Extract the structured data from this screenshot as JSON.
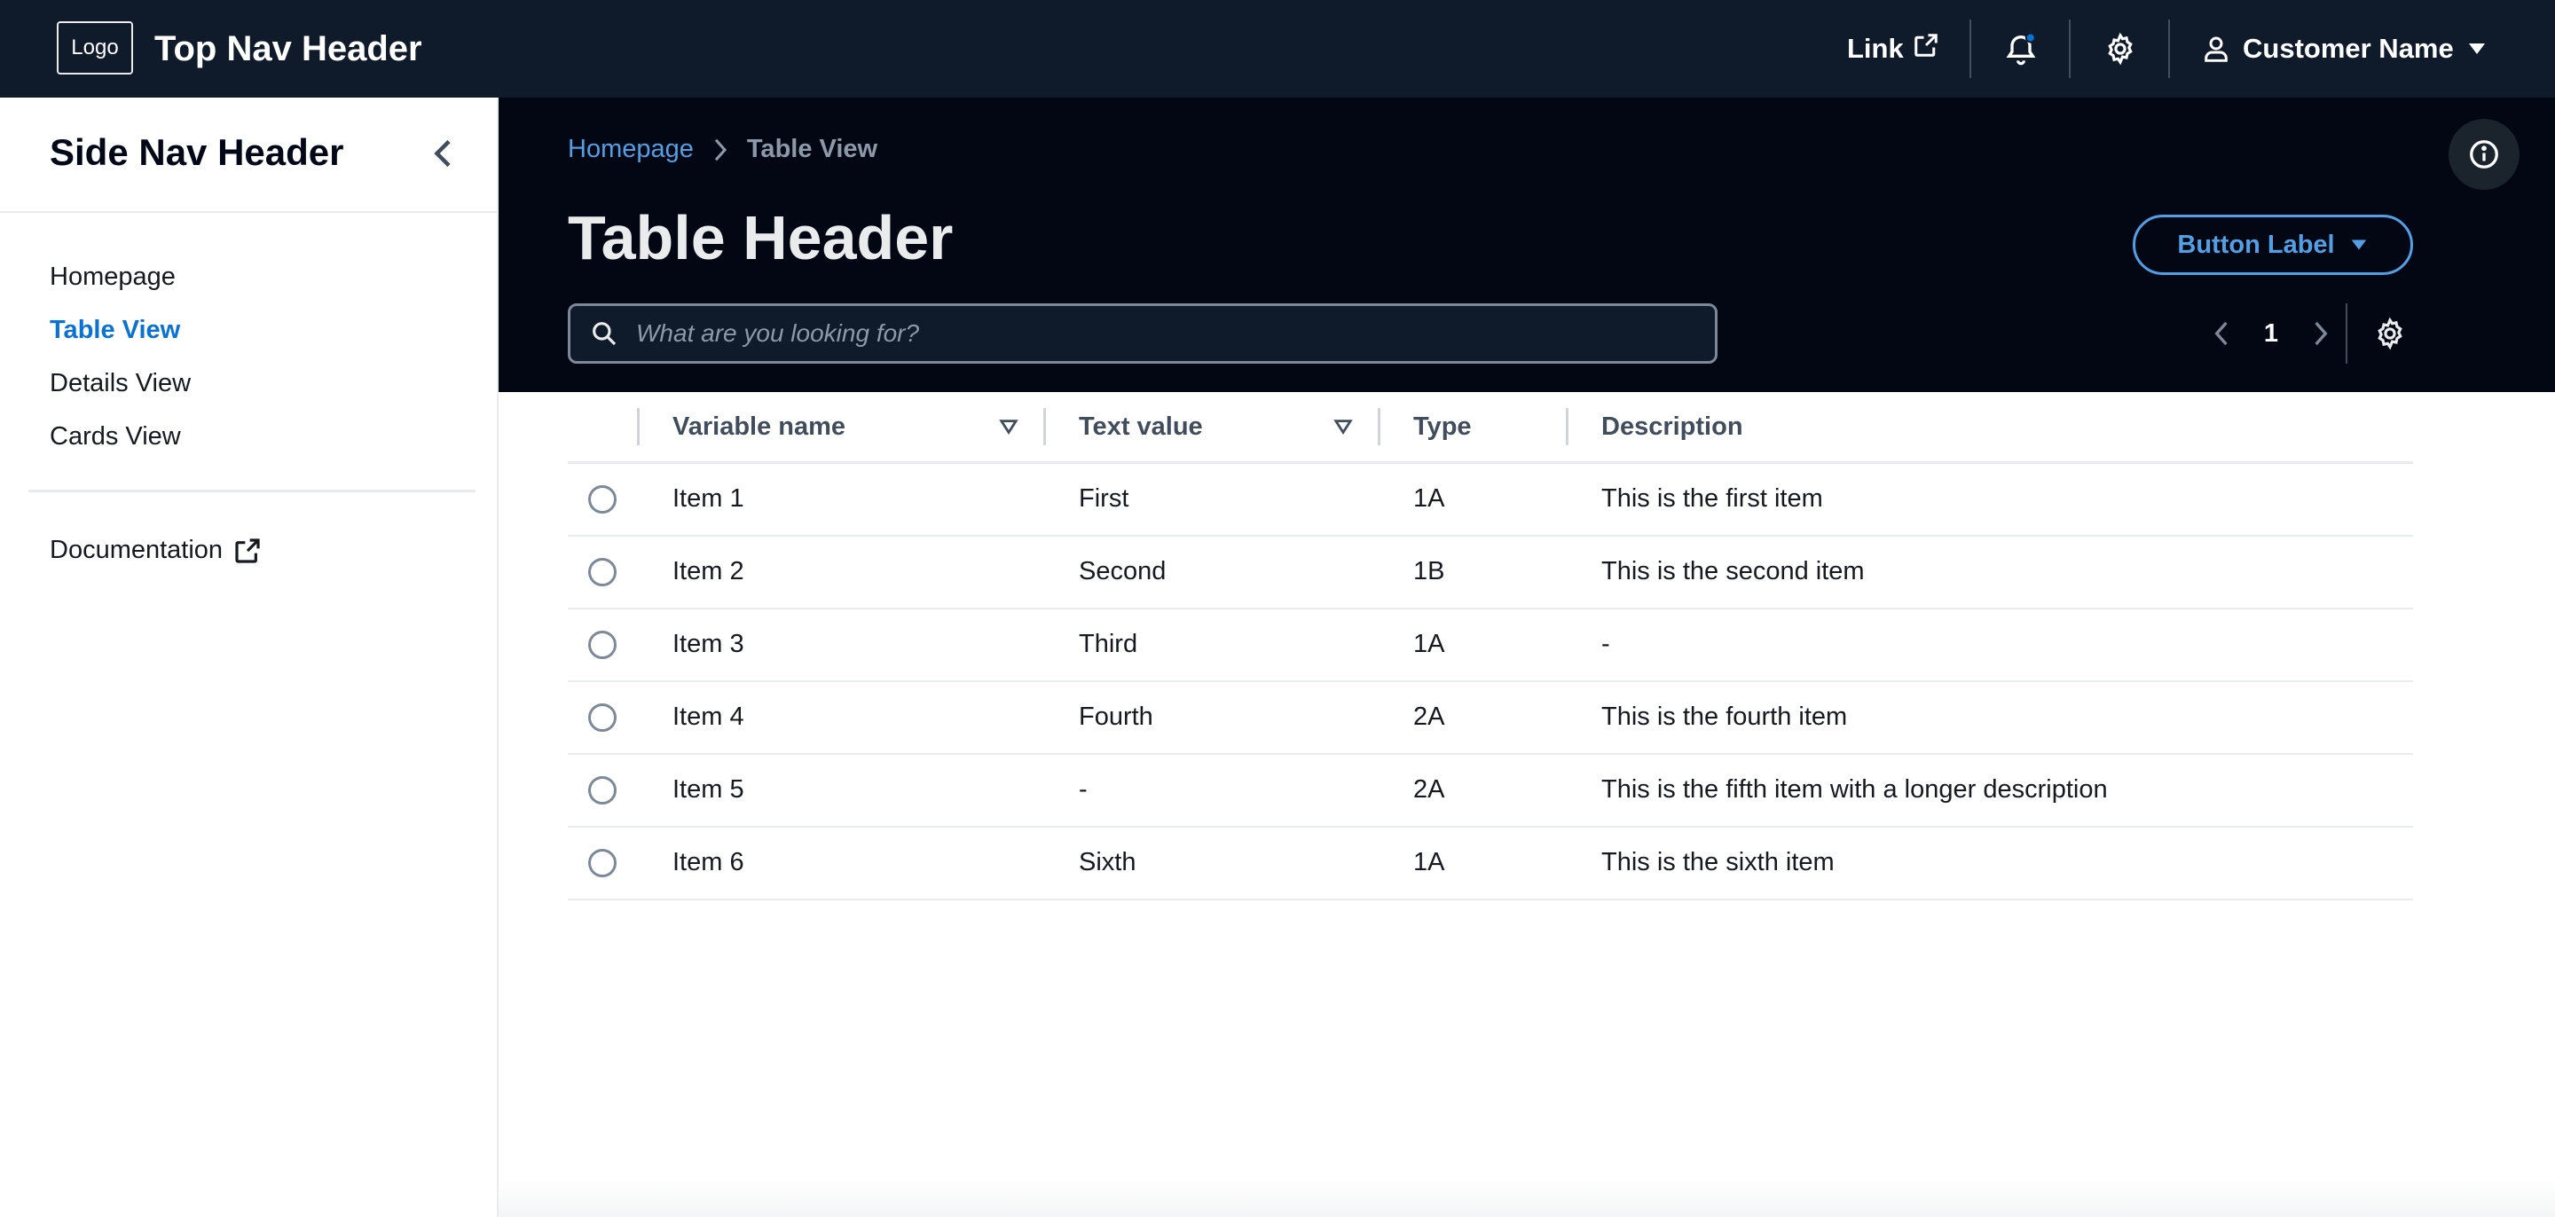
{
  "top_nav": {
    "logo": "Logo",
    "title": "Top Nav Header",
    "link_label": "Link",
    "user_name": "Customer Name",
    "notification_dot_color": "#0972d3"
  },
  "side_nav": {
    "header": "Side Nav Header",
    "items": [
      {
        "label": "Homepage",
        "active": false
      },
      {
        "label": "Table View",
        "active": true
      },
      {
        "label": "Details View",
        "active": false
      },
      {
        "label": "Cards View",
        "active": false
      }
    ],
    "documentation_label": "Documentation"
  },
  "content_header": {
    "breadcrumb": {
      "home": "Homepage",
      "current": "Table View"
    },
    "title": "Table Header",
    "dropdown_button_label": "Button Label",
    "search_placeholder": "What are you looking for?",
    "page_number": "1"
  },
  "table": {
    "columns": [
      "Variable name",
      "Text value",
      "Type",
      "Description"
    ],
    "rows": [
      {
        "name": "Item 1",
        "text": "First",
        "type": "1A",
        "description": "This is the first item"
      },
      {
        "name": "Item 2",
        "text": "Second",
        "type": "1B",
        "description": "This is the second item"
      },
      {
        "name": "Item 3",
        "text": "Third",
        "type": "1A",
        "description": "-"
      },
      {
        "name": "Item 4",
        "text": "Fourth",
        "type": "2A",
        "description": "This is the fourth item"
      },
      {
        "name": "Item 5",
        "text": "-",
        "type": "2A",
        "description": "This is the fifth item with a longer description"
      },
      {
        "name": "Item 6",
        "text": "Sixth",
        "type": "1A",
        "description": "This is the sixth item"
      }
    ]
  },
  "colors": {
    "top_nav_bg": "#0f1b2a",
    "content_header_bg": "#020713",
    "accent_blue": "#0972d3",
    "link_blue_dark": "#539fe5"
  }
}
